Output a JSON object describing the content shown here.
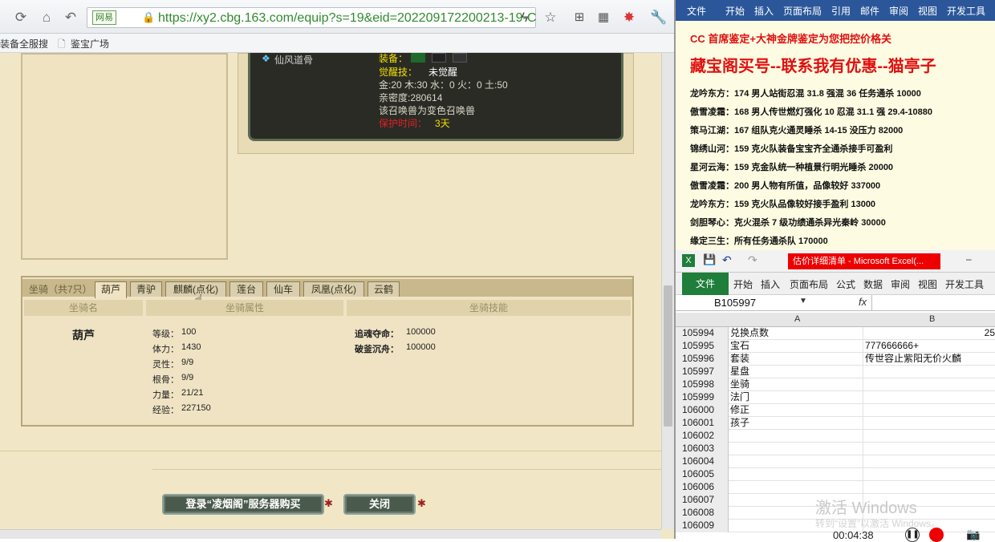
{
  "browser": {
    "url_site_tag": "网易",
    "url": "https://xy2.cbg.163.com/equip?s=19&eid=202209172200213-19-C",
    "bookmarks": [
      "装备全服搜",
      "鉴宝广场"
    ]
  },
  "pet": {
    "name": "仙风道骨",
    "equip_label": "装备：",
    "awaken_label": "觉醒技：",
    "awaken_value": "未觉醒",
    "elements": "金:20 木:30 水：0 火：0 土:50",
    "intimacy": "亲密度:280614",
    "summon_note": "该召唤兽为变色召唤兽",
    "protect_label": "保护时间：",
    "protect_value": "3天"
  },
  "mount": {
    "caption": "坐骑（共7只）",
    "tabs": [
      "葫芦",
      "青驴",
      "麒麟(点化)",
      "莲台",
      "仙车",
      "凤凰(点化)",
      "云鹤"
    ],
    "col_name": "坐骑名",
    "col_attr": "坐骑属性",
    "col_skill": "坐骑技能",
    "name": "葫芦",
    "attrs": [
      {
        "label": "等级：",
        "value": "100"
      },
      {
        "label": "体力：",
        "value": "1430"
      },
      {
        "label": "灵性：",
        "value": "9/9"
      },
      {
        "label": "根骨：",
        "value": "9/9"
      },
      {
        "label": "力量：",
        "value": "21/21"
      },
      {
        "label": "经验：",
        "value": "227150"
      }
    ],
    "skills": [
      {
        "label": "追魂夺命：",
        "value": "100000"
      },
      {
        "label": "破釜沉舟：",
        "value": "100000"
      }
    ]
  },
  "footer": {
    "buy_button": "登录“凌烟阁”服务器购买",
    "close_button": "关闭"
  },
  "word": {
    "ribbon": [
      "文件",
      "开始",
      "插入",
      "页面布局",
      "引用",
      "邮件",
      "审阅",
      "视图",
      "开发工具"
    ],
    "headline": "CC 首席鉴定+大神金牌鉴定为您把控价格关",
    "title": "藏宝阁买号--联系我有优惠--猫亭子",
    "lines": [
      "龙吟东方：174 男人站街忍混 31.8 强混 36 任务通杀 10000",
      "傲雪凌霜：168 男人传世燃灯强化 10 忍混 31.1 强 29.4-10880",
      "策马江湖：167 组队克火通灵睡杀 14-15 没压力 82000",
      "锦绣山河：159 克火队装备宝宝齐全通杀接手可盈利",
      "星河云海：159 克金队统一种植景行明光睡杀 20000",
      "傲雪凌霜：200 男人物有所值，品像较好 337000",
      "龙吟东方：159 克火队品像较好接手盈利 13000",
      "剑胆琴心：克火混杀 7 级功绩通杀异光秦岭 30000",
      "缘定三生：所有任务通杀队 170000"
    ]
  },
  "excel": {
    "title": "估价详细清单 - Microsoft Excel(...",
    "file_tab": "文件",
    "ribbon": [
      "开始",
      "插入",
      "页面布局",
      "公式",
      "数据",
      "审阅",
      "视图",
      "开发工具"
    ],
    "name_box": "B105997",
    "fx": "fx",
    "col_a": "A",
    "col_b": "B",
    "rows": [
      {
        "n": "105994",
        "a": "兑换点数",
        "b": "25"
      },
      {
        "n": "105995",
        "a": "宝石",
        "b": "777666666+"
      },
      {
        "n": "105996",
        "a": "套装",
        "b": "传世容止紫阳无价火麟"
      },
      {
        "n": "105997",
        "a": "星盘",
        "b": ""
      },
      {
        "n": "105998",
        "a": "坐骑",
        "b": ""
      },
      {
        "n": "105999",
        "a": "法门",
        "b": ""
      },
      {
        "n": "106000",
        "a": "修正",
        "b": ""
      },
      {
        "n": "106001",
        "a": "孩子",
        "b": ""
      },
      {
        "n": "106002",
        "a": "",
        "b": ""
      },
      {
        "n": "106003",
        "a": "",
        "b": ""
      },
      {
        "n": "106004",
        "a": "",
        "b": ""
      },
      {
        "n": "106005",
        "a": "",
        "b": ""
      },
      {
        "n": "106006",
        "a": "",
        "b": ""
      },
      {
        "n": "106007",
        "a": "",
        "b": ""
      },
      {
        "n": "106008",
        "a": "",
        "b": ""
      },
      {
        "n": "106009",
        "a": "",
        "b": ""
      }
    ],
    "watermark": "激活 Windows",
    "watermark_sub": "转到“设置”以激活 Windows。",
    "timer": "00:04:38"
  }
}
